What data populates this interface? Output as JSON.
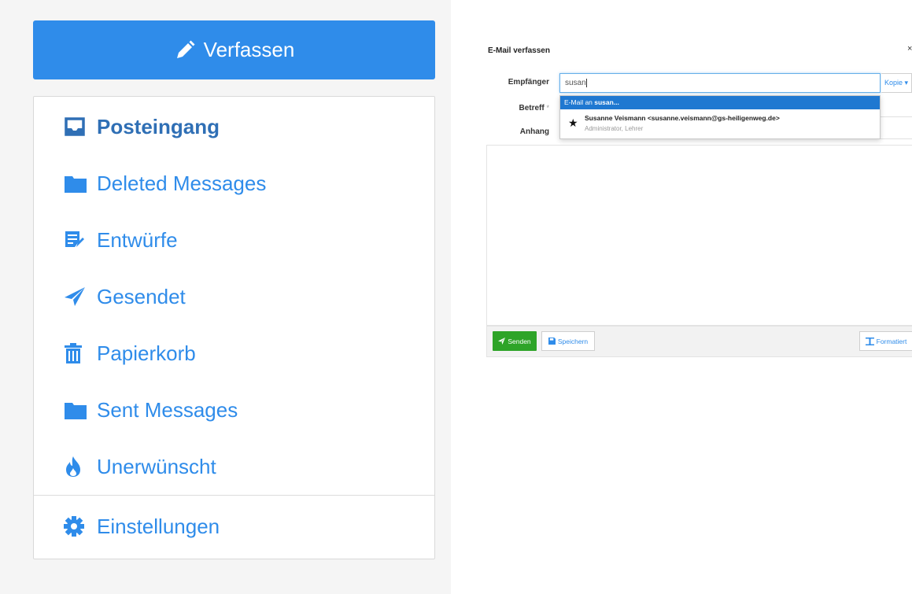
{
  "sidebar": {
    "compose_label": "Verfassen",
    "folders": [
      {
        "label": "Posteingang",
        "icon": "inbox-icon",
        "active": true
      },
      {
        "label": "Deleted Messages",
        "icon": "folder-icon"
      },
      {
        "label": "Entwürfe",
        "icon": "draft-icon"
      },
      {
        "label": "Gesendet",
        "icon": "paper-plane-icon"
      },
      {
        "label": "Papierkorb",
        "icon": "trash-icon"
      },
      {
        "label": "Sent Messages",
        "icon": "folder-icon"
      },
      {
        "label": "Unerwünscht",
        "icon": "fire-icon"
      }
    ],
    "settings_label": "Einstellungen"
  },
  "compose": {
    "title": "E-Mail verfassen",
    "close": "×",
    "to_label": "Empfänger",
    "to_value": "susan",
    "copy_label": "Kopie ▾",
    "subject_label": "Betreff",
    "subject_required": "*",
    "attachment_label": "Anhang",
    "autocomplete": {
      "highlight_prefix": "E-Mail an ",
      "highlight_term": "susan...",
      "contact_name": "Susanne Veismann <susanne.veismann@gs-heiligenweg.de>",
      "contact_role": "Administrator, Lehrer"
    },
    "send_label": "Senden",
    "save_label": "Speichern",
    "format_label": "Formatiert"
  },
  "colors": {
    "primary": "#2f8cea",
    "success": "#2ea428",
    "highlight": "#1f78d1"
  }
}
